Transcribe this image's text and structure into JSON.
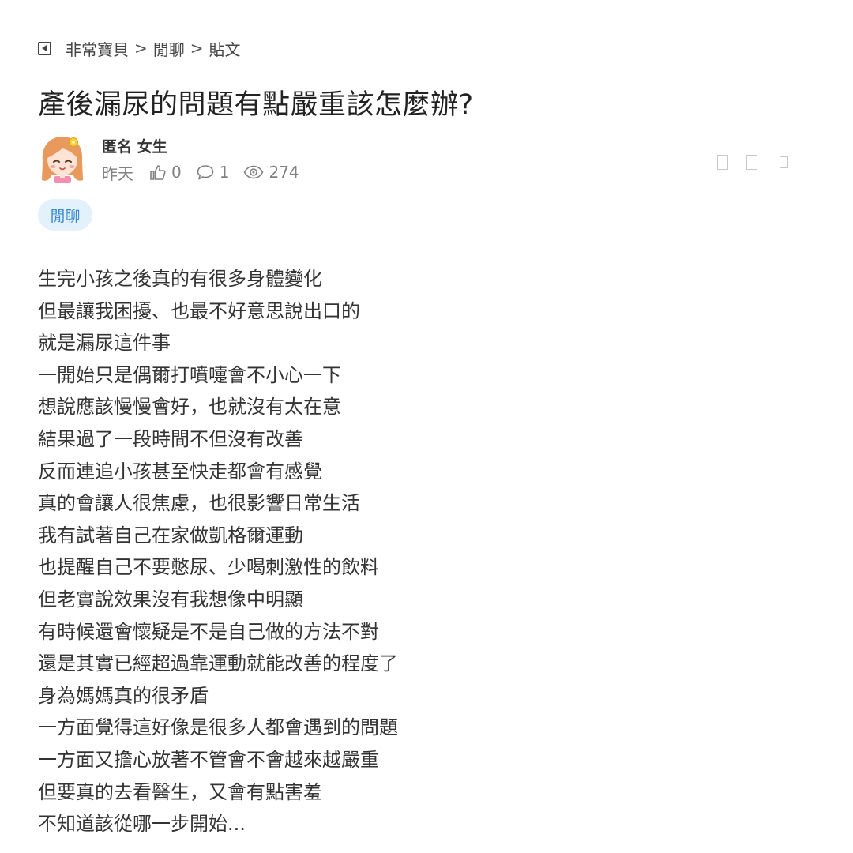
{
  "breadcrumb": {
    "items": [
      "非常寶貝",
      "閒聊",
      "貼文"
    ],
    "separator": ">"
  },
  "post": {
    "title": "產後漏尿的問題有點嚴重該怎麼辦?",
    "author": {
      "name": "匿名 女生",
      "avatar": "cartoon-girl-avatar"
    },
    "meta": {
      "time": "昨天",
      "likes": "0",
      "comments": "1",
      "views": "274"
    },
    "tag": "閒聊",
    "body_lines": [
      "生完小孩之後真的有很多身體變化",
      "但最讓我困擾、也最不好意思說出口的",
      "就是漏尿這件事",
      "一開始只是偶爾打噴嚏會不小心一下",
      "想說應該慢慢會好，也就沒有太在意",
      "結果過了一段時間不但沒有改善",
      "反而連追小孩甚至快走都會有感覺",
      "真的會讓人很焦慮，也很影響日常生活",
      "我有試著自己在家做凱格爾運動",
      "也提醒自己不要憋尿、少喝刺激性的飲料",
      "但老實說效果沒有我想像中明顯",
      "有時候還會懷疑是不是自己做的方法不對",
      "還是其實已經超過靠運動就能改善的程度了",
      "身為媽媽真的很矛盾",
      "一方面覺得這好像是很多人都會遇到的問題",
      "一方面又擔心放著不管會不會越來越嚴重",
      "但要真的去看醫生，又會有點害羞",
      "不知道該從哪一步開始..."
    ]
  },
  "colors": {
    "tag_background": "#e3f1fb",
    "tag_text": "#3a8bd0",
    "meta_text": "#808080"
  }
}
